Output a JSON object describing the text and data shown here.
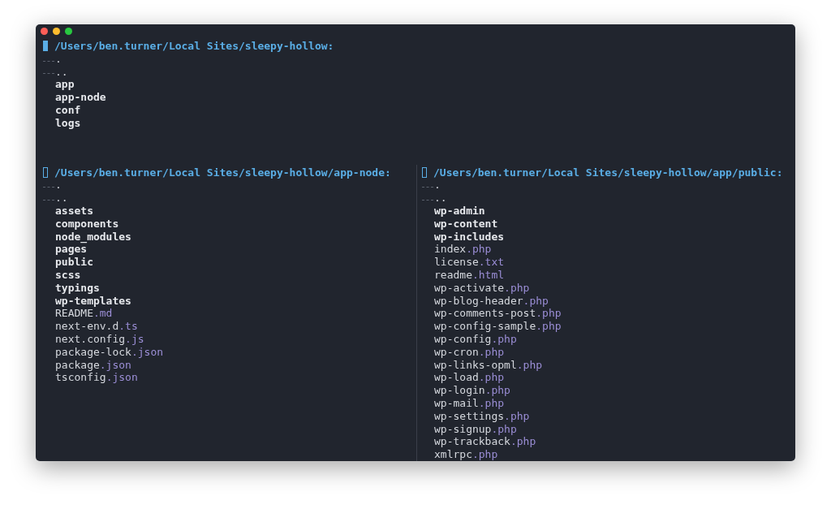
{
  "panes": [
    {
      "path": "/Users/ben.turner/Local Sites/sleepy-hollow:",
      "selected": true,
      "entries": [
        {
          "kind": "nav",
          "name": "."
        },
        {
          "kind": "nav",
          "name": ".."
        },
        {
          "kind": "dir",
          "name": "app"
        },
        {
          "kind": "dir",
          "name": "app-node"
        },
        {
          "kind": "dir",
          "name": "conf"
        },
        {
          "kind": "dir",
          "name": "logs"
        }
      ]
    },
    {
      "path": "/Users/ben.turner/Local Sites/sleepy-hollow/app-node:",
      "selected": false,
      "entries": [
        {
          "kind": "nav",
          "name": "."
        },
        {
          "kind": "nav",
          "name": ".."
        },
        {
          "kind": "dir",
          "name": "assets"
        },
        {
          "kind": "dir",
          "name": "components"
        },
        {
          "kind": "dir",
          "name": "node_modules"
        },
        {
          "kind": "dir",
          "name": "pages"
        },
        {
          "kind": "dir",
          "name": "public"
        },
        {
          "kind": "dir",
          "name": "scss"
        },
        {
          "kind": "dir",
          "name": "typings"
        },
        {
          "kind": "dir",
          "name": "wp-templates"
        },
        {
          "kind": "file",
          "name": "README",
          "ext": ".md"
        },
        {
          "kind": "file",
          "name": "next-env.d",
          "ext": ".ts"
        },
        {
          "kind": "file",
          "name": "next.config",
          "ext": ".js"
        },
        {
          "kind": "file",
          "name": "package-lock",
          "ext": ".json"
        },
        {
          "kind": "file",
          "name": "package",
          "ext": ".json"
        },
        {
          "kind": "file",
          "name": "tsconfig",
          "ext": ".json"
        }
      ]
    },
    {
      "path": "/Users/ben.turner/Local Sites/sleepy-hollow/app/public:",
      "selected": false,
      "entries": [
        {
          "kind": "nav",
          "name": "."
        },
        {
          "kind": "nav",
          "name": ".."
        },
        {
          "kind": "dir",
          "name": "wp-admin"
        },
        {
          "kind": "dir",
          "name": "wp-content"
        },
        {
          "kind": "dir",
          "name": "wp-includes"
        },
        {
          "kind": "file",
          "name": "index",
          "ext": ".php"
        },
        {
          "kind": "file",
          "name": "license",
          "ext": ".txt"
        },
        {
          "kind": "file",
          "name": "readme",
          "ext": ".html"
        },
        {
          "kind": "file",
          "name": "wp-activate",
          "ext": ".php"
        },
        {
          "kind": "file",
          "name": "wp-blog-header",
          "ext": ".php"
        },
        {
          "kind": "file",
          "name": "wp-comments-post",
          "ext": ".php"
        },
        {
          "kind": "file",
          "name": "wp-config-sample",
          "ext": ".php"
        },
        {
          "kind": "file",
          "name": "wp-config",
          "ext": ".php"
        },
        {
          "kind": "file",
          "name": "wp-cron",
          "ext": ".php"
        },
        {
          "kind": "file",
          "name": "wp-links-opml",
          "ext": ".php"
        },
        {
          "kind": "file",
          "name": "wp-load",
          "ext": ".php"
        },
        {
          "kind": "file",
          "name": "wp-login",
          "ext": ".php"
        },
        {
          "kind": "file",
          "name": "wp-mail",
          "ext": ".php"
        },
        {
          "kind": "file",
          "name": "wp-settings",
          "ext": ".php"
        },
        {
          "kind": "file",
          "name": "wp-signup",
          "ext": ".php"
        },
        {
          "kind": "file",
          "name": "wp-trackback",
          "ext": ".php"
        },
        {
          "kind": "file",
          "name": "xmlrpc",
          "ext": ".php"
        }
      ]
    }
  ]
}
